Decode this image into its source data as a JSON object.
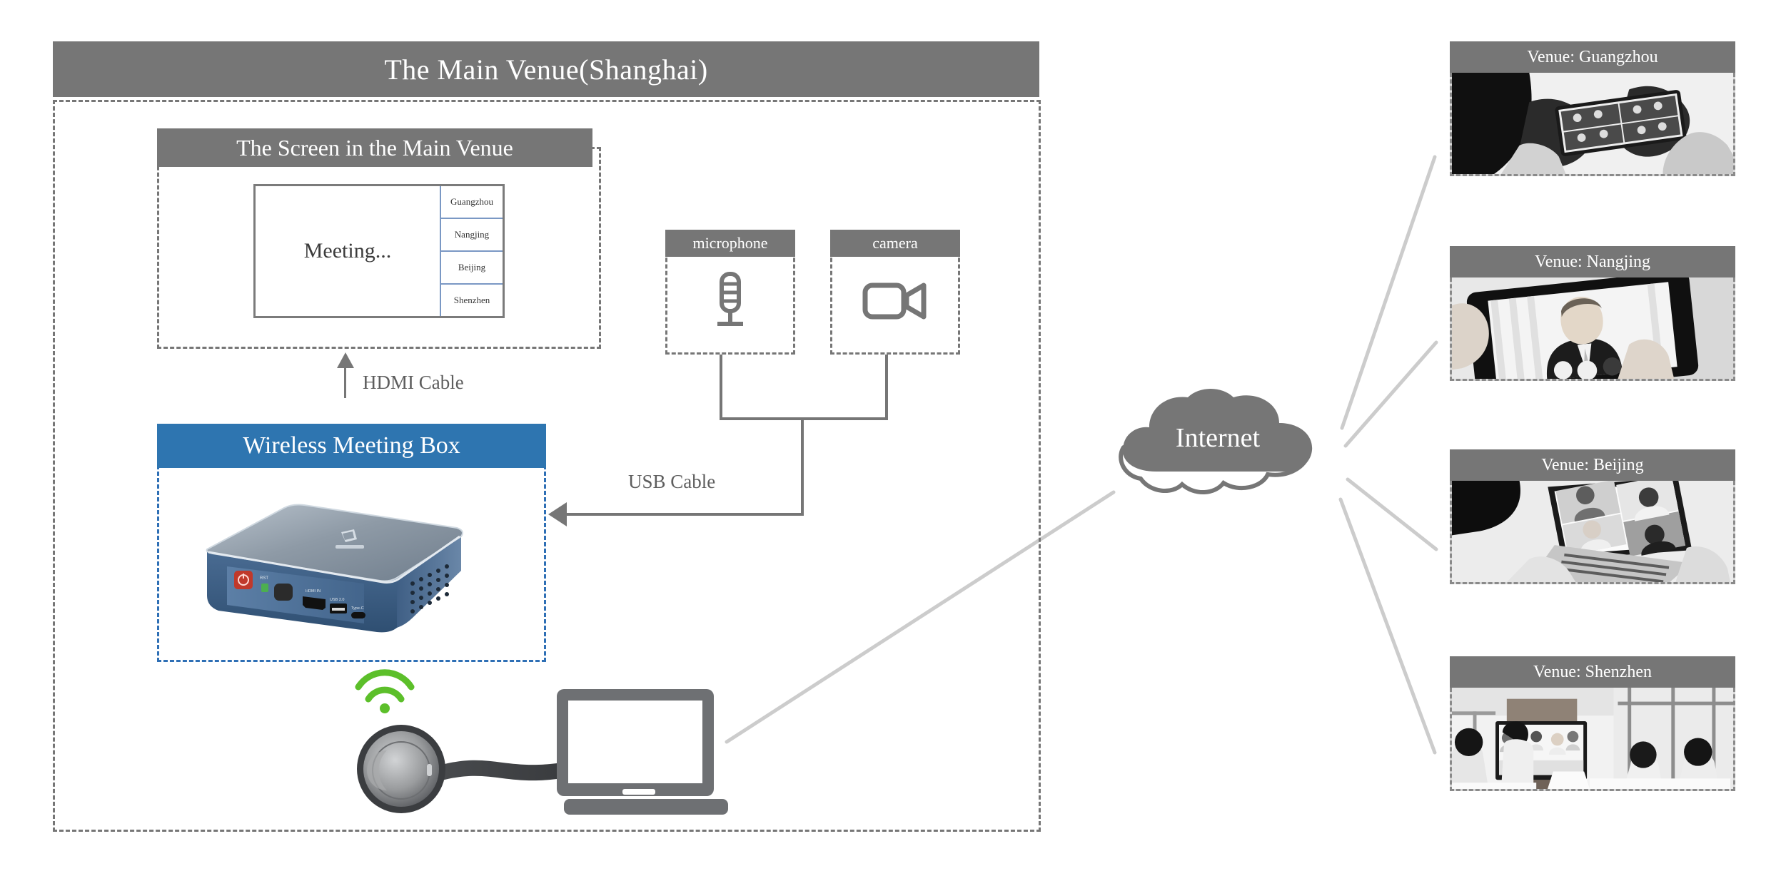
{
  "main_venue": {
    "title": "The Main Venue(Shanghai)",
    "screen": {
      "title": "The Screen in the Main Venue",
      "main_text": "Meeting...",
      "participants": [
        "Guangzhou",
        "Nangjing",
        "Beijing",
        "Shenzhen"
      ]
    },
    "wireless_box": {
      "title": "Wireless Meeting Box",
      "photo_alt": "wireless-meeting-box-device",
      "ports": [
        "HDMI IN",
        "USB 2.0",
        "Type-C"
      ],
      "reset_label": "RST"
    },
    "devices": [
      {
        "title": "microphone",
        "icon": "microphone-icon"
      },
      {
        "title": "camera",
        "icon": "video-camera-icon"
      }
    ],
    "cables": {
      "hdmi": "HDMI Cable",
      "usb": "USB Cable"
    },
    "dongle": {
      "icon": "wireless-dongle-icon",
      "signal_icon": "wifi-signal-icon"
    },
    "laptop": {
      "icon": "laptop-icon"
    }
  },
  "cloud": {
    "label": "Internet",
    "icon": "cloud-icon"
  },
  "venues": [
    {
      "label": "Venue: Guangzhou",
      "photo_alt": "hands-holding-phone-video-grid"
    },
    {
      "label": "Venue: Nangjing",
      "photo_alt": "tablet-video-call-man-in-suit"
    },
    {
      "label": "Venue: Beijing",
      "photo_alt": "laptop-four-way-video-call"
    },
    {
      "label": "Venue: Shenzhen",
      "photo_alt": "conference-room-with-large-display"
    }
  ],
  "colors": {
    "gray_bar": "#767676",
    "blue_bar": "#2e75b0",
    "link_line": "#cccccc",
    "screen_border": "#7a98c4",
    "wire": "#767676"
  }
}
